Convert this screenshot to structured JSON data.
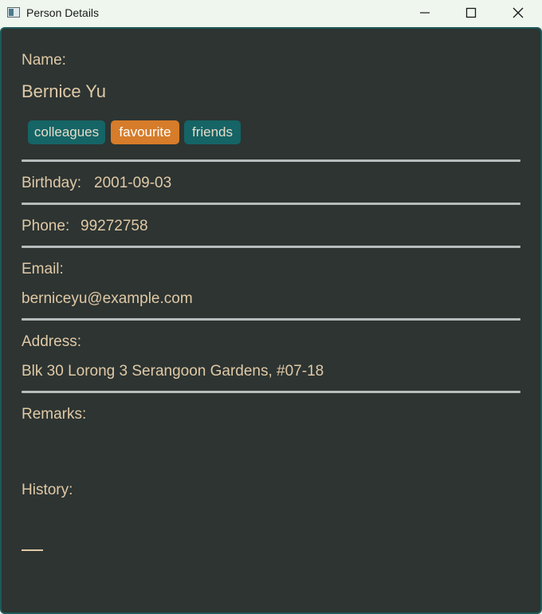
{
  "window": {
    "title": "Person Details",
    "app_icon": "window-app-icon",
    "controls": [
      "minimize-icon",
      "maximize-icon",
      "close-icon"
    ]
  },
  "colors": {
    "panel_bg": "#2d3432",
    "text": "#e0c9a6",
    "tag_teal": "#156466",
    "tag_orange": "#d67c2a",
    "divider": "#b8bcbc"
  },
  "person": {
    "name_label": "Name:",
    "name": "Bernice Yu",
    "tags": [
      "colleagues",
      "favourite",
      "friends"
    ],
    "birthday_label": "Birthday:",
    "birthday": "2001-09-03",
    "phone_label": "Phone:",
    "phone": "99272758",
    "email_label": "Email:",
    "email": "berniceyu@example.com",
    "address_label": "Address:",
    "address": "Blk 30 Lorong 3 Serangoon Gardens, #07-18",
    "remarks_label": "Remarks:",
    "remarks": "",
    "history_label": "History:"
  }
}
